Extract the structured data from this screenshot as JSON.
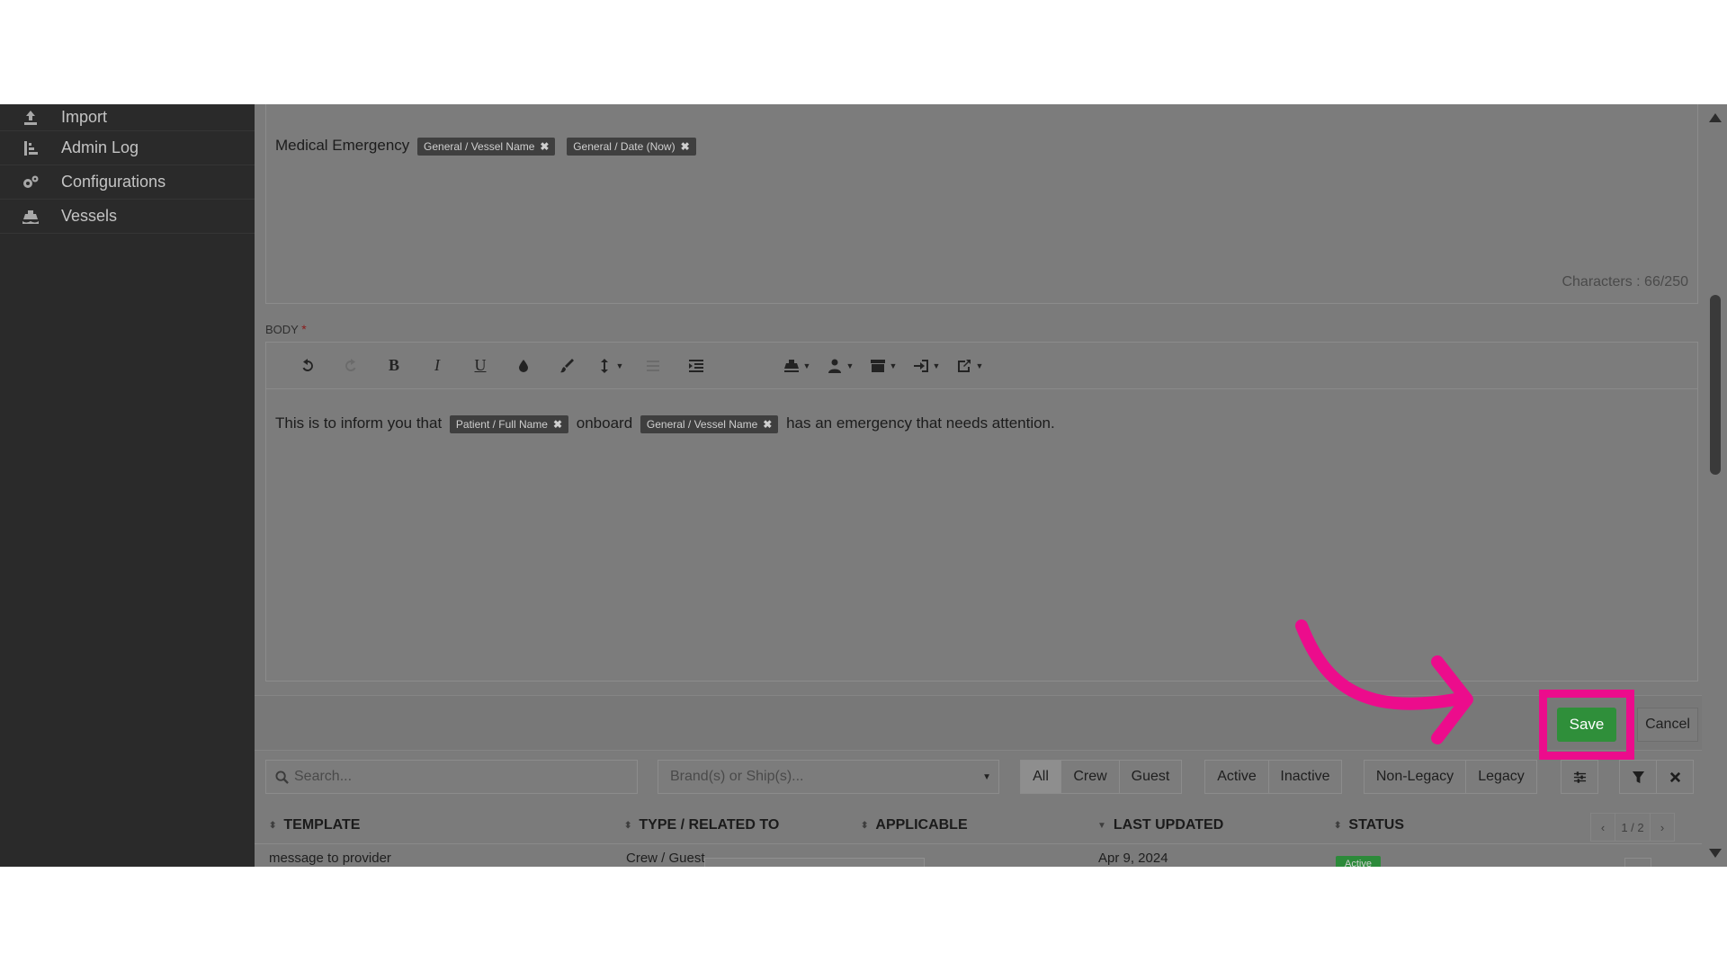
{
  "sidebar": {
    "items": [
      {
        "label": "Import",
        "icon": "upload-icon"
      },
      {
        "label": "Admin Log",
        "icon": "sort-list-icon"
      },
      {
        "label": "Configurations",
        "icon": "gears-icon"
      },
      {
        "label": "Vessels",
        "icon": "ship-icon"
      }
    ]
  },
  "subject": {
    "text": "Medical Emergency",
    "tags": [
      "General / Vessel Name",
      "General / Date (Now)"
    ],
    "char_count": "Characters : 66/250"
  },
  "body": {
    "label": "BODY",
    "required_mark": "*",
    "text_before": "This is to inform you that",
    "tag1": "Patient / Full Name",
    "text_middle": "onboard",
    "tag2": "General / Vessel Name",
    "text_after": "has an emergency that needs attention."
  },
  "tag_remove_glyph": "✖",
  "actions": {
    "save": "Save",
    "cancel": "Cancel"
  },
  "filters": {
    "search_placeholder": "Search...",
    "brand_placeholder": "Brand(s) or Ship(s)...",
    "audience": [
      "All",
      "Crew",
      "Guest"
    ],
    "status": [
      "Active",
      "Inactive"
    ],
    "legacy": [
      "Non-Legacy",
      "Legacy"
    ]
  },
  "table": {
    "headers": [
      "TEMPLATE",
      "TYPE / RELATED TO",
      "APPLICABLE",
      "LAST UPDATED",
      "STATUS"
    ],
    "pager": "1 / 2",
    "row": {
      "template": "message to provider",
      "type": "Crew / Guest",
      "updated": "Apr 9, 2024",
      "status": "Active"
    }
  },
  "colors": {
    "highlight": "#ec0c8c",
    "save_button": "#2f8f3a"
  }
}
